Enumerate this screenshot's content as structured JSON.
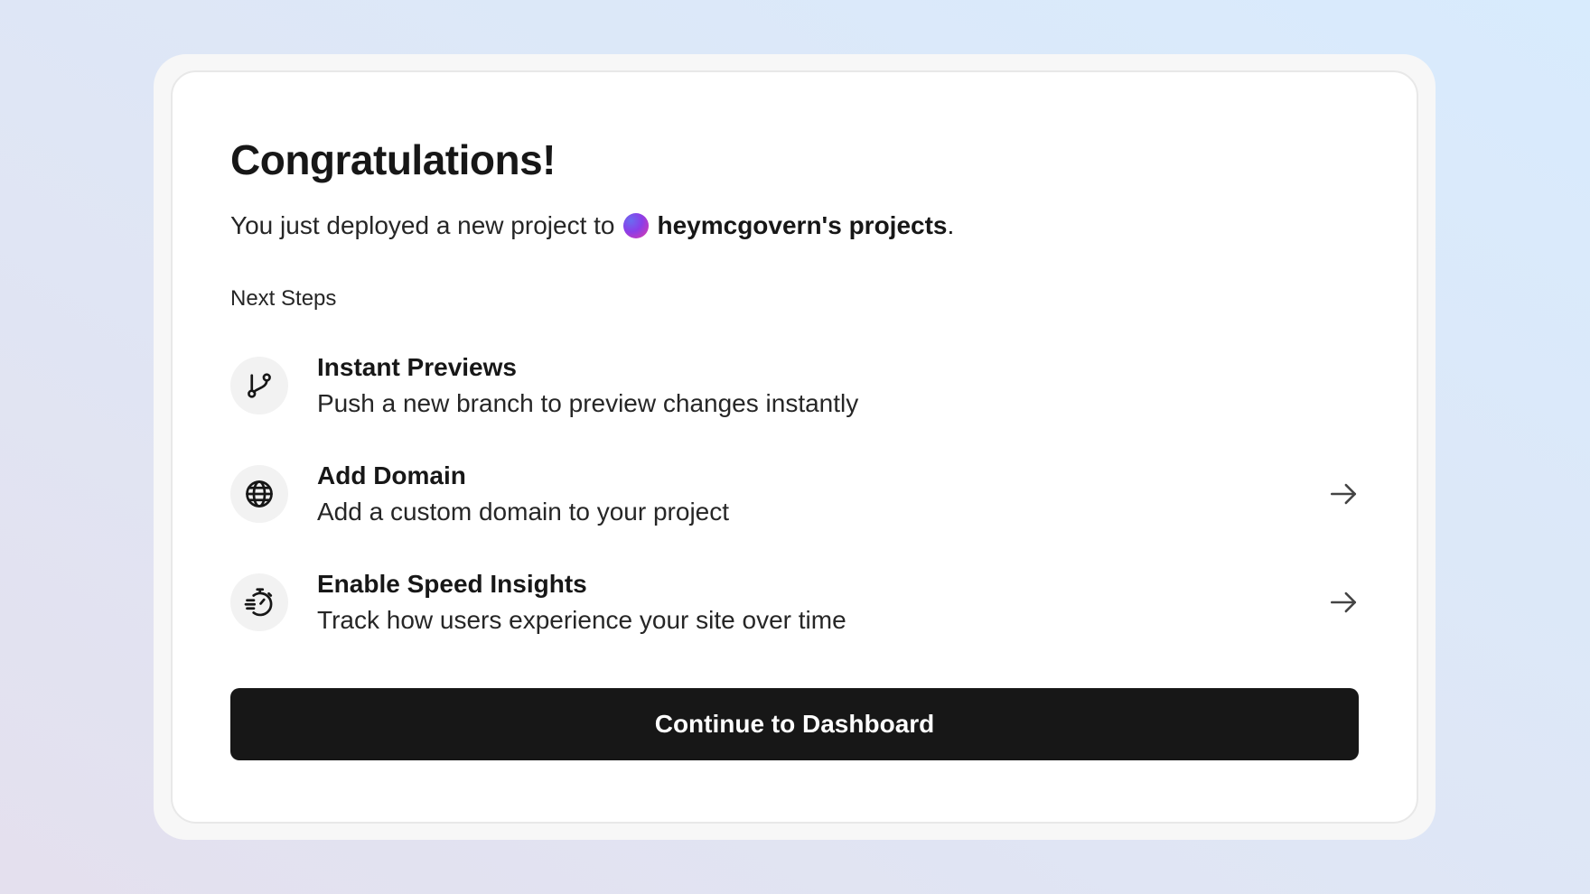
{
  "header": {
    "title": "Congratulations!",
    "subtitle_prefix": "You just deployed a new project to",
    "team_name": "heymcgovern's projects",
    "subtitle_suffix": "."
  },
  "next_steps": {
    "label": "Next Steps",
    "items": [
      {
        "icon": "git-branch-icon",
        "title": "Instant Previews",
        "description": "Push a new branch to preview changes instantly",
        "has_arrow": false
      },
      {
        "icon": "globe-icon",
        "title": "Add Domain",
        "description": "Add a custom domain to your project",
        "has_arrow": true
      },
      {
        "icon": "speed-stopwatch-icon",
        "title": "Enable Speed Insights",
        "description": "Track how users experience your site over time",
        "has_arrow": true
      }
    ]
  },
  "actions": {
    "continue_label": "Continue to Dashboard"
  },
  "colors": {
    "button_background": "#171717",
    "icon_circle": "#f2f2f2",
    "avatar_gradient_start": "#6a6cf0",
    "avatar_gradient_end": "#e23aa6"
  }
}
